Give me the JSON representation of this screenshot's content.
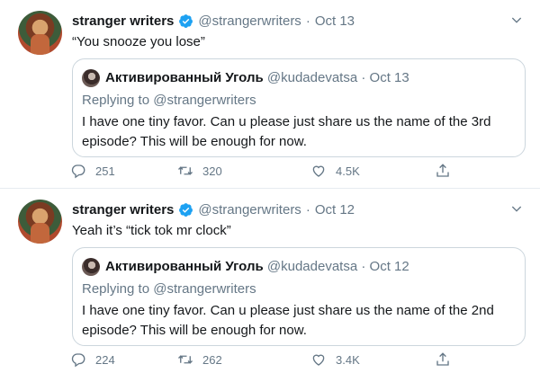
{
  "tweets": [
    {
      "author_name": "stranger writers",
      "handle": "@strangerwriters",
      "separator": "·",
      "date": "Oct 13",
      "text": "“You snooze you lose”",
      "quoted": {
        "author_name": "Активированный Уголь",
        "handle": "@kudadevatsa",
        "separator": "·",
        "date": "Oct 13",
        "replying_label": "Replying to",
        "replying_to": "@strangerwriters",
        "text": "I have one tiny favor. Can u please just share us the name of the 3rd episode? This will be enough for now."
      },
      "replies": "251",
      "retweets": "320",
      "likes": "4.5K"
    },
    {
      "author_name": "stranger writers",
      "handle": "@strangerwriters",
      "separator": "·",
      "date": "Oct 12",
      "text": "Yeah it’s “tick tok mr clock”",
      "quoted": {
        "author_name": "Активированный Уголь",
        "handle": "@kudadevatsa",
        "separator": "·",
        "date": "Oct 12",
        "replying_label": "Replying to",
        "replying_to": "@strangerwriters",
        "text": "I have one tiny favor. Can u please just share us the name of the 2nd episode? This will be enough for now."
      },
      "replies": "224",
      "retweets": "262",
      "likes": "3.4K"
    }
  ],
  "colors": {
    "text": "#14171a",
    "muted": "#657786",
    "verified": "#1da1f2",
    "border": "#ccd6dd"
  },
  "icons": [
    "verified-badge-icon",
    "chevron-down-icon",
    "reply-icon",
    "retweet-icon",
    "like-icon",
    "share-icon"
  ]
}
